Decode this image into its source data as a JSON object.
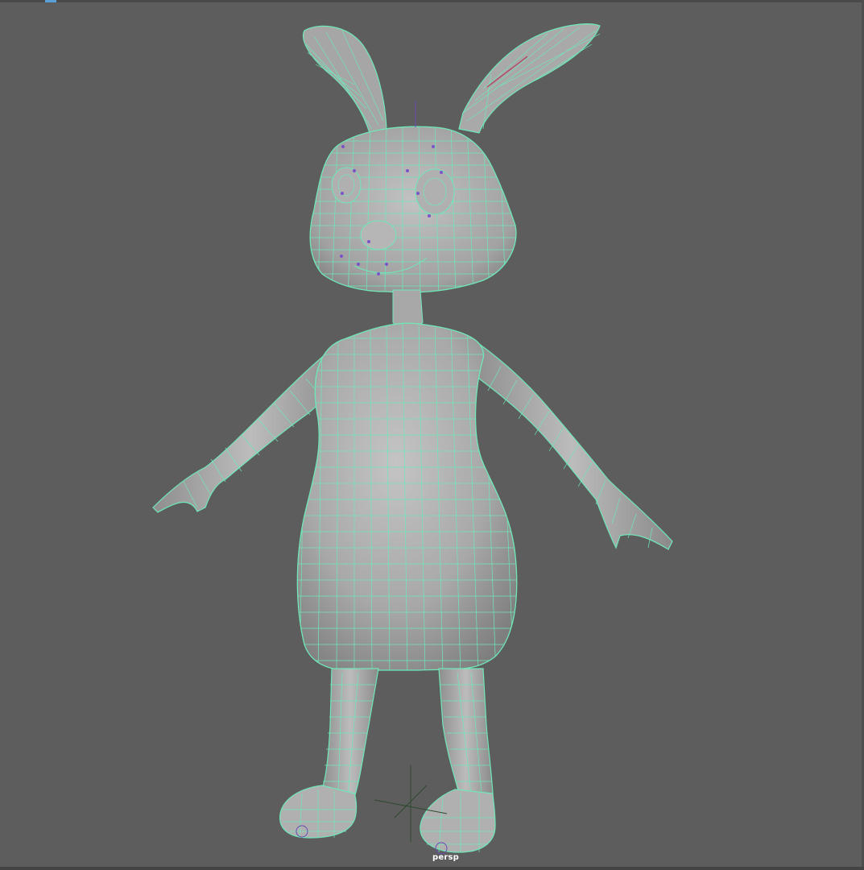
{
  "viewport": {
    "camera_name": "persp",
    "background_color": "#5d5d5d",
    "wireframe_color": "#6fe8b8",
    "mesh_color": "#a9a9a9"
  },
  "scene": {
    "model_name": "rabbit-character-mesh",
    "pose": "A-pose"
  }
}
